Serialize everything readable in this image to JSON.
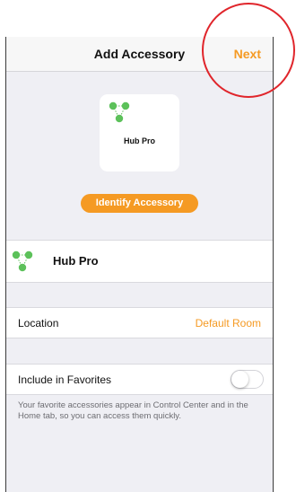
{
  "navbar": {
    "title": "Add Accessory",
    "next_label": "Next"
  },
  "accessory_card": {
    "name": "Hub Pro",
    "icon": "hub-network-icon"
  },
  "identify_button": {
    "label": "Identify Accessory"
  },
  "accessory_row": {
    "name": "Hub Pro",
    "icon": "hub-network-icon"
  },
  "location": {
    "label": "Location",
    "value": "Default Room"
  },
  "favorites": {
    "label": "Include in Favorites",
    "enabled": false,
    "description": "Your favorite accessories appear in Control Center and in the Home tab, so you can access them quickly."
  },
  "colors": {
    "accent": "#f59a23",
    "icon_green": "#5cc15a",
    "annotation_red": "#e0252b"
  }
}
